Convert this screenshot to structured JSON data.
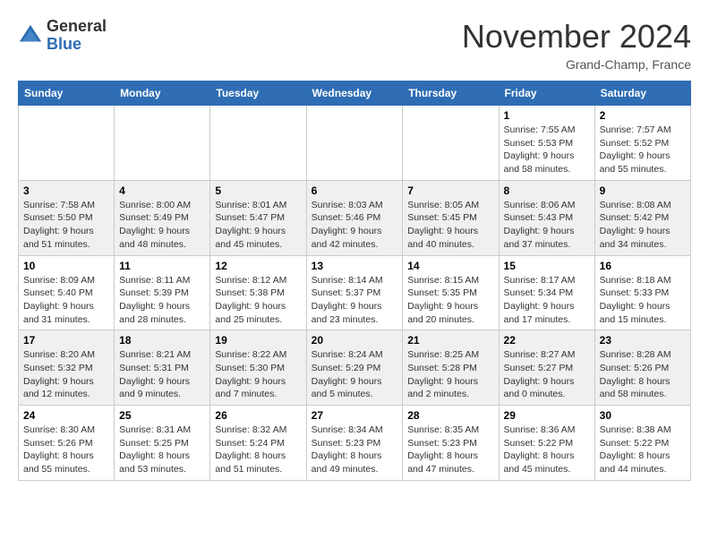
{
  "header": {
    "logo_general": "General",
    "logo_blue": "Blue",
    "title": "November 2024",
    "location": "Grand-Champ, France"
  },
  "days_of_week": [
    "Sunday",
    "Monday",
    "Tuesday",
    "Wednesday",
    "Thursday",
    "Friday",
    "Saturday"
  ],
  "weeks": [
    [
      {
        "day": "",
        "info": ""
      },
      {
        "day": "",
        "info": ""
      },
      {
        "day": "",
        "info": ""
      },
      {
        "day": "",
        "info": ""
      },
      {
        "day": "",
        "info": ""
      },
      {
        "day": "1",
        "info": "Sunrise: 7:55 AM\nSunset: 5:53 PM\nDaylight: 9 hours and 58 minutes."
      },
      {
        "day": "2",
        "info": "Sunrise: 7:57 AM\nSunset: 5:52 PM\nDaylight: 9 hours and 55 minutes."
      }
    ],
    [
      {
        "day": "3",
        "info": "Sunrise: 7:58 AM\nSunset: 5:50 PM\nDaylight: 9 hours and 51 minutes."
      },
      {
        "day": "4",
        "info": "Sunrise: 8:00 AM\nSunset: 5:49 PM\nDaylight: 9 hours and 48 minutes."
      },
      {
        "day": "5",
        "info": "Sunrise: 8:01 AM\nSunset: 5:47 PM\nDaylight: 9 hours and 45 minutes."
      },
      {
        "day": "6",
        "info": "Sunrise: 8:03 AM\nSunset: 5:46 PM\nDaylight: 9 hours and 42 minutes."
      },
      {
        "day": "7",
        "info": "Sunrise: 8:05 AM\nSunset: 5:45 PM\nDaylight: 9 hours and 40 minutes."
      },
      {
        "day": "8",
        "info": "Sunrise: 8:06 AM\nSunset: 5:43 PM\nDaylight: 9 hours and 37 minutes."
      },
      {
        "day": "9",
        "info": "Sunrise: 8:08 AM\nSunset: 5:42 PM\nDaylight: 9 hours and 34 minutes."
      }
    ],
    [
      {
        "day": "10",
        "info": "Sunrise: 8:09 AM\nSunset: 5:40 PM\nDaylight: 9 hours and 31 minutes."
      },
      {
        "day": "11",
        "info": "Sunrise: 8:11 AM\nSunset: 5:39 PM\nDaylight: 9 hours and 28 minutes."
      },
      {
        "day": "12",
        "info": "Sunrise: 8:12 AM\nSunset: 5:38 PM\nDaylight: 9 hours and 25 minutes."
      },
      {
        "day": "13",
        "info": "Sunrise: 8:14 AM\nSunset: 5:37 PM\nDaylight: 9 hours and 23 minutes."
      },
      {
        "day": "14",
        "info": "Sunrise: 8:15 AM\nSunset: 5:35 PM\nDaylight: 9 hours and 20 minutes."
      },
      {
        "day": "15",
        "info": "Sunrise: 8:17 AM\nSunset: 5:34 PM\nDaylight: 9 hours and 17 minutes."
      },
      {
        "day": "16",
        "info": "Sunrise: 8:18 AM\nSunset: 5:33 PM\nDaylight: 9 hours and 15 minutes."
      }
    ],
    [
      {
        "day": "17",
        "info": "Sunrise: 8:20 AM\nSunset: 5:32 PM\nDaylight: 9 hours and 12 minutes."
      },
      {
        "day": "18",
        "info": "Sunrise: 8:21 AM\nSunset: 5:31 PM\nDaylight: 9 hours and 9 minutes."
      },
      {
        "day": "19",
        "info": "Sunrise: 8:22 AM\nSunset: 5:30 PM\nDaylight: 9 hours and 7 minutes."
      },
      {
        "day": "20",
        "info": "Sunrise: 8:24 AM\nSunset: 5:29 PM\nDaylight: 9 hours and 5 minutes."
      },
      {
        "day": "21",
        "info": "Sunrise: 8:25 AM\nSunset: 5:28 PM\nDaylight: 9 hours and 2 minutes."
      },
      {
        "day": "22",
        "info": "Sunrise: 8:27 AM\nSunset: 5:27 PM\nDaylight: 9 hours and 0 minutes."
      },
      {
        "day": "23",
        "info": "Sunrise: 8:28 AM\nSunset: 5:26 PM\nDaylight: 8 hours and 58 minutes."
      }
    ],
    [
      {
        "day": "24",
        "info": "Sunrise: 8:30 AM\nSunset: 5:26 PM\nDaylight: 8 hours and 55 minutes."
      },
      {
        "day": "25",
        "info": "Sunrise: 8:31 AM\nSunset: 5:25 PM\nDaylight: 8 hours and 53 minutes."
      },
      {
        "day": "26",
        "info": "Sunrise: 8:32 AM\nSunset: 5:24 PM\nDaylight: 8 hours and 51 minutes."
      },
      {
        "day": "27",
        "info": "Sunrise: 8:34 AM\nSunset: 5:23 PM\nDaylight: 8 hours and 49 minutes."
      },
      {
        "day": "28",
        "info": "Sunrise: 8:35 AM\nSunset: 5:23 PM\nDaylight: 8 hours and 47 minutes."
      },
      {
        "day": "29",
        "info": "Sunrise: 8:36 AM\nSunset: 5:22 PM\nDaylight: 8 hours and 45 minutes."
      },
      {
        "day": "30",
        "info": "Sunrise: 8:38 AM\nSunset: 5:22 PM\nDaylight: 8 hours and 44 minutes."
      }
    ]
  ]
}
